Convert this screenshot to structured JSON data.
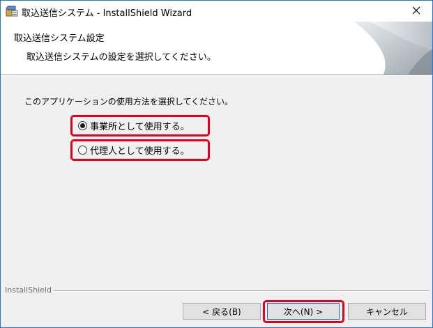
{
  "window": {
    "title": "取込送信システム - InstallShield Wizard",
    "close_symbol": "×"
  },
  "banner": {
    "title": "取込送信システム設定",
    "subtitle": "取込送信システムの設定を選択してください。"
  },
  "main": {
    "prompt": "このアプリケーションの使用方法を選択してください。",
    "options": [
      {
        "label": "事業所として使用する。",
        "selected": true
      },
      {
        "label": "代理人として使用する。",
        "selected": false
      }
    ]
  },
  "footer": {
    "brand": "InstallShield",
    "back_label": "< 戻る(B)",
    "next_label": "次へ(N) >",
    "cancel_label": "キャンセル"
  },
  "colors": {
    "highlight": "#e3001b",
    "accent": "#0078d7"
  }
}
